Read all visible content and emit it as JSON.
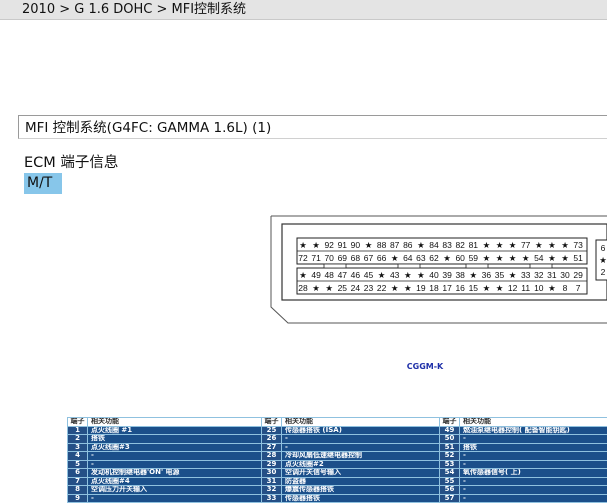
{
  "breadcrumb": "2010 > G 1.6 DOHC > MFI控制系统",
  "section_title": "MFI 控制系统(G4FC: GAMMA 1.6L) (1)",
  "sub_title": "ECM 端子信息",
  "tag": "M/T",
  "connector": {
    "top_row_1": [
      "★",
      "★",
      "92",
      "91",
      "90",
      "★",
      "88",
      "87",
      "86",
      "★",
      "84",
      "83",
      "82",
      "81",
      "★",
      "★",
      "★",
      "77",
      "★",
      "★",
      "★",
      "73"
    ],
    "top_row_2": [
      "72",
      "71",
      "70",
      "69",
      "68",
      "67",
      "66",
      "★",
      "64",
      "63",
      "62",
      "★",
      "60",
      "59",
      "★",
      "★",
      "★",
      "★",
      "54",
      "★",
      "★",
      "51"
    ],
    "bottom_row_1": [
      "★",
      "49",
      "48",
      "47",
      "46",
      "45",
      "★",
      "43",
      "★",
      "★",
      "40",
      "39",
      "38",
      "★",
      "36",
      "35",
      "★",
      "33",
      "32",
      "31",
      "30",
      "29"
    ],
    "bottom_row_2": [
      "28",
      "★",
      "★",
      "25",
      "24",
      "23",
      "22",
      "★",
      "★",
      "19",
      "18",
      "17",
      "16",
      "15",
      "★",
      "★",
      "12",
      "11",
      "10",
      "★",
      "8",
      "7"
    ],
    "side_pins": [
      "6",
      "★",
      "2"
    ]
  },
  "caption": "CGGM-K",
  "table": {
    "headers": [
      "端子",
      "相关功能",
      "端子",
      "相关功能",
      "端子",
      "相关功能"
    ],
    "rows": [
      [
        "1",
        "点火线圈 #1",
        "25",
        "传感器搭铁 (ISA)",
        "49",
        "燃油泵继电器控制( 配备智能钥匙)"
      ],
      [
        "2",
        "搭铁",
        "26",
        "-",
        "50",
        "-"
      ],
      [
        "3",
        "点火线圈#3",
        "27",
        "-",
        "51",
        "搭铁"
      ],
      [
        "4",
        "-",
        "28",
        "冷却风扇低速继电器控制",
        "52",
        "-"
      ],
      [
        "5",
        "-",
        "29",
        "点火线圈#2",
        "53",
        "-"
      ],
      [
        "6",
        "发动机控制继电器'ON' 电源",
        "30",
        "空调开关信号输入",
        "54",
        "氧传感器信号( 上)"
      ],
      [
        "7",
        "点火线圈#4",
        "31",
        "防盗器",
        "55",
        "-"
      ],
      [
        "8",
        "空调压力开关输入",
        "32",
        "爆震传感器搭铁",
        "56",
        "-"
      ],
      [
        "9",
        "-",
        "33",
        "传感器搭铁",
        "57",
        "-"
      ]
    ]
  }
}
